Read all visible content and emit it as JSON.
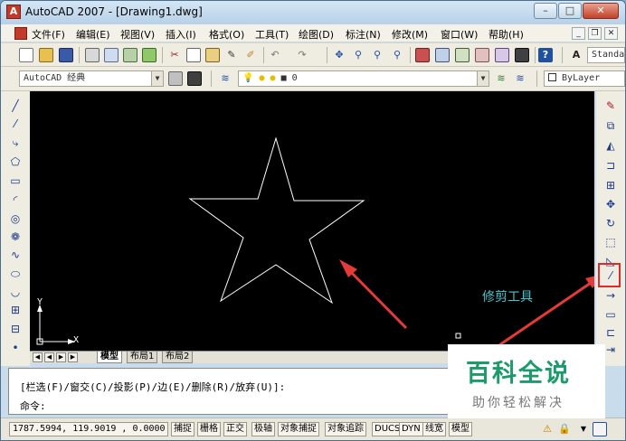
{
  "window": {
    "title": "AutoCAD 2007 - [Drawing1.dwg]",
    "min": "–",
    "max": "□",
    "close": "✕"
  },
  "menu": [
    "文件(F)",
    "编辑(E)",
    "视图(V)",
    "插入(I)",
    "格式(O)",
    "工具(T)",
    "绘图(D)",
    "标注(N)",
    "修改(M)",
    "窗口(W)",
    "帮助(H)"
  ],
  "mdi": {
    "min": "_",
    "restore": "❐",
    "close": "✕"
  },
  "toolbar": {
    "textstyle_value": "Standa"
  },
  "workspace": {
    "value": "AutoCAD 经典"
  },
  "layer": {
    "value": "0"
  },
  "color": {
    "value": "ByLayer"
  },
  "tabs": {
    "model": "模型",
    "layout1": "布局1",
    "layout2": "布局2"
  },
  "ucs": {
    "x": "X",
    "y": "Y"
  },
  "annotation": {
    "label": "修剪工具",
    "color": "#4fc0c8"
  },
  "command": {
    "line1": "[栏选(F)/窗交(C)/投影(P)/边(E)/删除(R)/放弃(U)]:",
    "line2": "命令:"
  },
  "status": {
    "coords": "1787.5994, 119.9019 , 0.0000",
    "buttons": [
      "捕捉",
      "栅格",
      "正交",
      "极轴",
      "对象捕捉",
      "对象追踪",
      "DUCS",
      "DYN",
      "线宽",
      "模型"
    ]
  },
  "watermark": {
    "main": "百科全说",
    "sub": "助你轻松解决"
  },
  "colors": {
    "canvas": "#000000",
    "arrow": "#e43a3a",
    "star": "#ffffff"
  }
}
